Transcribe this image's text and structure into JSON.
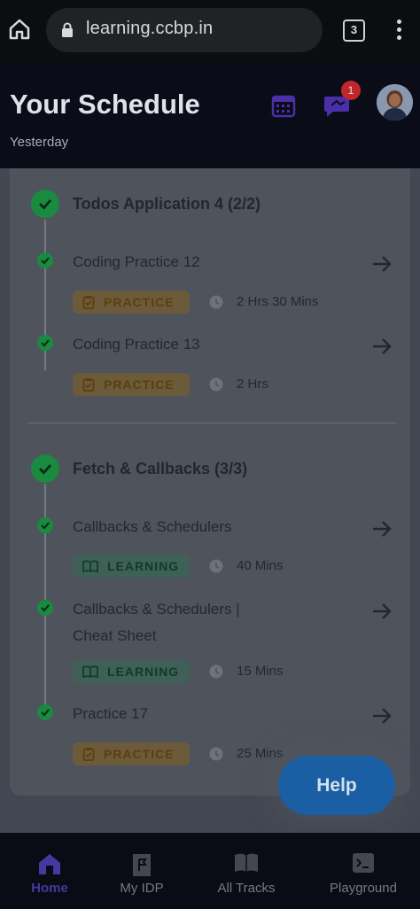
{
  "browser": {
    "url": "learning.ccbp.in",
    "tab_count": "3"
  },
  "header": {
    "title": "Your Schedule",
    "subtitle": "Yesterday",
    "notification_count": "1"
  },
  "modules": [
    {
      "title": "Todos Application 4 (2/2)",
      "items": [
        {
          "title": "Coding Practice 12",
          "tag": "PRACTICE",
          "duration": "2 Hrs 30 Mins"
        },
        {
          "title": "Coding Practice 13",
          "tag": "PRACTICE",
          "duration": "2 Hrs"
        }
      ]
    },
    {
      "title": "Fetch & Callbacks (3/3)",
      "items": [
        {
          "title": "Callbacks & Schedulers",
          "tag": "LEARNING",
          "duration": "40 Mins"
        },
        {
          "title": "Callbacks & Schedulers |",
          "title_line2": "Cheat Sheet",
          "tag": "LEARNING",
          "duration": "15 Mins"
        },
        {
          "title": "Practice 17",
          "tag": "PRACTICE",
          "duration": "25 Mins"
        }
      ]
    }
  ],
  "help_button": "Help",
  "bottom_nav": [
    {
      "label": "Home",
      "icon": "home-icon",
      "active": true
    },
    {
      "label": "My IDP",
      "icon": "flag-icon",
      "active": false
    },
    {
      "label": "All Tracks",
      "icon": "book-icon",
      "active": false
    },
    {
      "label": "Playground",
      "icon": "terminal-icon",
      "active": false
    }
  ],
  "colors": {
    "accent": "#4937a0",
    "success": "#198a3f",
    "practice_tag": "#6b5b3b",
    "learning_tag": "#3f6057",
    "help": "#1a5fa4"
  }
}
